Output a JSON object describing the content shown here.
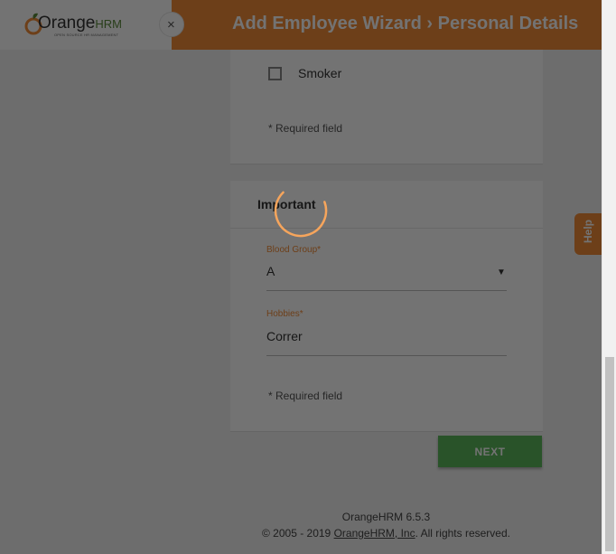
{
  "header": {
    "title": "Add Employee Wizard › Personal Details"
  },
  "logo": {
    "text_orange": "Orange",
    "text_hrm": "HRM",
    "tagline": "OPEN SOURCE HR MANAGEMENT"
  },
  "close_tab": {
    "glyph": "×"
  },
  "card1": {
    "smoker_label": "Smoker",
    "required_note": "* Required field"
  },
  "card2": {
    "section_title": "Important",
    "blood_group": {
      "label": "Blood Group",
      "required_marker": "*",
      "value": "A",
      "arrow": "▼"
    },
    "hobbies": {
      "label": "Hobbies",
      "required_marker": "*",
      "value": "Correr"
    },
    "required_note": "* Required field"
  },
  "next_button": {
    "label": "NEXT"
  },
  "help": {
    "label": "Help"
  },
  "footer": {
    "version": "OrangeHRM 6.5.3",
    "copy_prefix": "© 2005 - 2019 ",
    "copy_link": "OrangeHRM, Inc",
    "copy_suffix": ". All rights reserved."
  },
  "colors": {
    "brand_orange": "#f28c38",
    "next_green": "#5cb85c",
    "overlay": "rgba(0,0,0,0.55)"
  }
}
